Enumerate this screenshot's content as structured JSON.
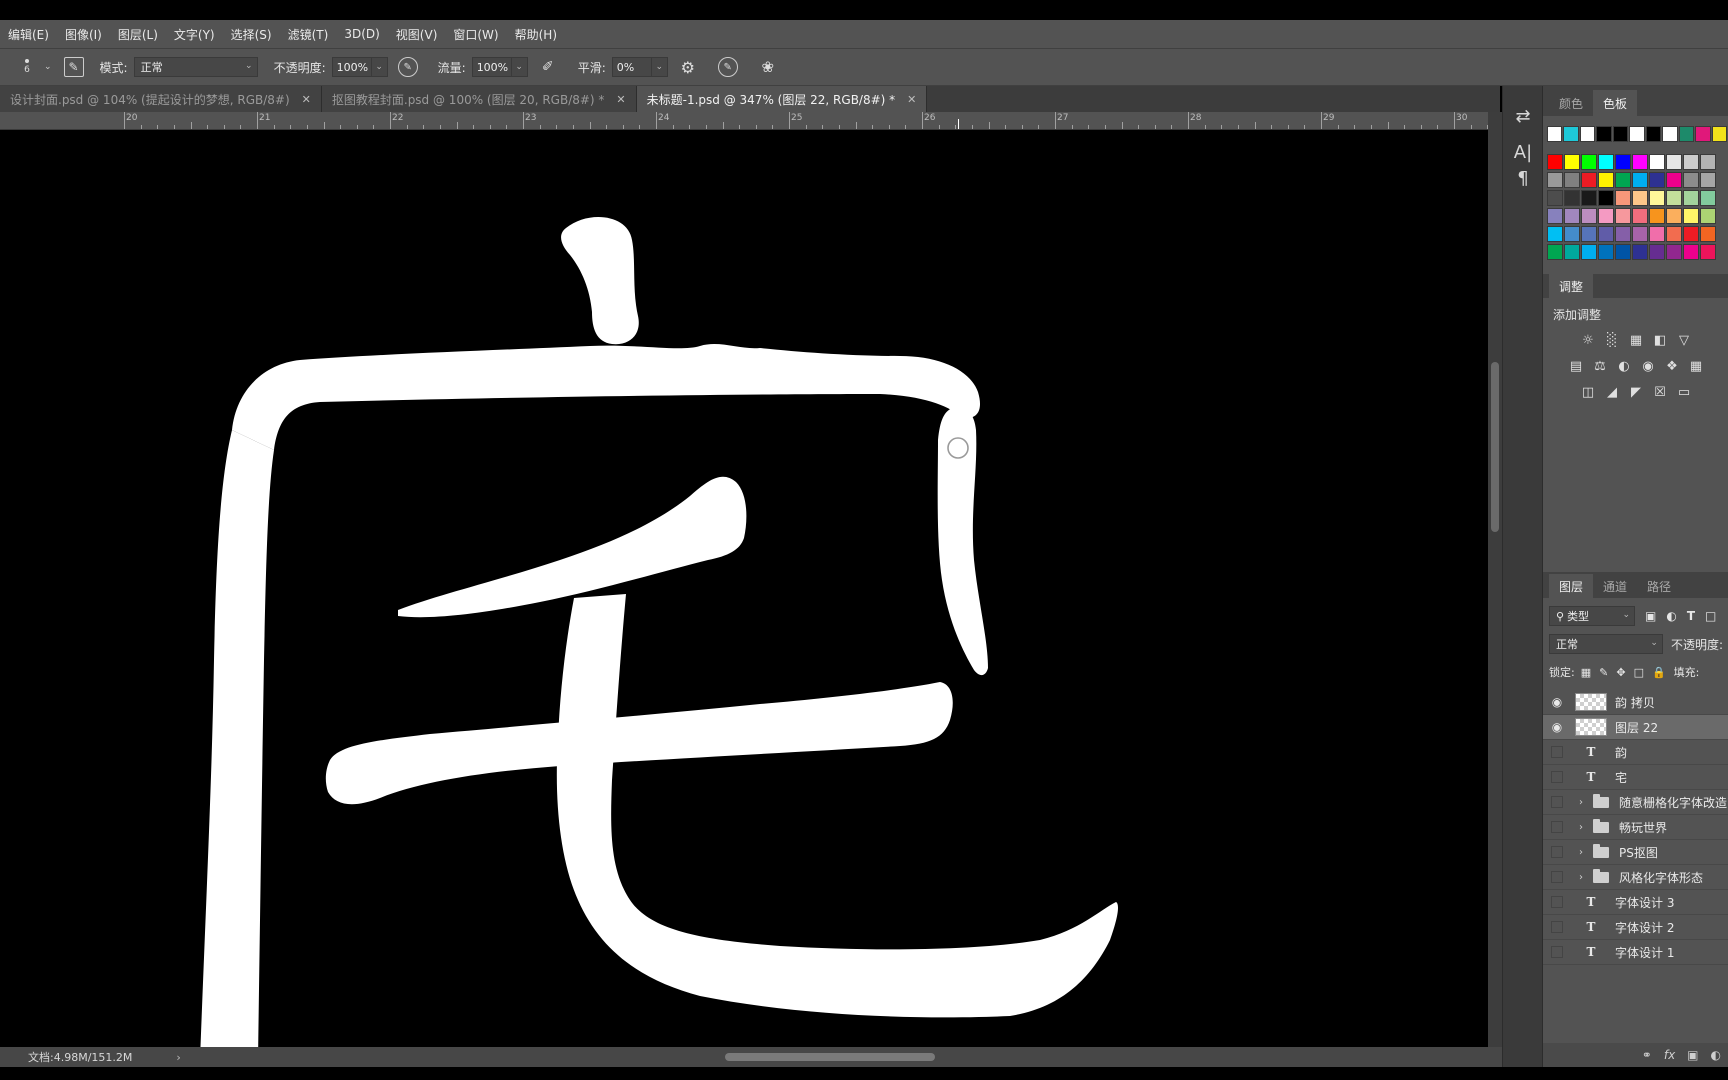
{
  "menu": [
    "编辑(E)",
    "图像(I)",
    "图层(L)",
    "文字(Y)",
    "选择(S)",
    "滤镜(T)",
    "3D(D)",
    "视图(V)",
    "窗口(W)",
    "帮助(H)"
  ],
  "options": {
    "brush_size": "6",
    "mode_label": "模式:",
    "mode_value": "正常",
    "opacity_label": "不透明度:",
    "opacity_value": "100%",
    "flow_label": "流量:",
    "flow_value": "100%",
    "smooth_label": "平滑:",
    "smooth_value": "0%"
  },
  "tabs": [
    {
      "label": "设计封面.psd @ 104% (提起设计的梦想, RGB/8#)",
      "active": false
    },
    {
      "label": "抠图教程封面.psd @ 100% (图层 20, RGB/8#) *",
      "active": false
    },
    {
      "label": "未标题-1.psd @ 347% (图层 22, RGB/8#) *",
      "active": true
    }
  ],
  "ruler_labels": [
    "20",
    "21",
    "22",
    "23",
    "24",
    "25",
    "26",
    "27",
    "28",
    "29",
    "30"
  ],
  "status": {
    "doc_info": "文档:4.98M/151.2M"
  },
  "panels": {
    "color_tabs": [
      "颜色",
      "色板"
    ],
    "adjust_tab": "调整",
    "adjust_add": "添加调整",
    "layer_tabs": [
      "图层",
      "通道",
      "路径"
    ],
    "filter_kind": "类型",
    "blend_mode": "正常",
    "opacity_label": "不透明度:",
    "lock_label": "锁定:",
    "fill_label": "填充:",
    "footer_fx": "fx"
  },
  "swatches": {
    "row0": [
      "#ffffff",
      "#1ec8d8",
      "#ffffff",
      "#000000",
      "#000000",
      "#ffffff",
      "#000000",
      "#ffffff",
      "#1d8a6a",
      "#e0187a",
      "#f2e21a"
    ],
    "grid": [
      [
        "#ff0000",
        "#ffff00",
        "#00ff00",
        "#00ffff",
        "#0000ff",
        "#ff00ff",
        "#ffffff",
        "#e6e6e6",
        "#cccccc",
        "#b3b3b3"
      ],
      [
        "#999999",
        "#808080",
        "#ed1c24",
        "#fff200",
        "#00a651",
        "#00aeef",
        "#2e3192",
        "#ec008c",
        "#8c8c8c",
        "#a6a6a6"
      ],
      [
        "#4d4d4d",
        "#333333",
        "#1a1a1a",
        "#000000",
        "#f7977a",
        "#fdc689",
        "#fff799",
        "#c4df9b",
        "#a3d39c",
        "#82ca9d"
      ],
      [
        "#8781bd",
        "#a187be",
        "#bc8dbf",
        "#f49ac2",
        "#f6989d",
        "#f26d7d",
        "#f7941d",
        "#fbaf5d",
        "#fff568",
        "#acd373"
      ],
      [
        "#00bff3",
        "#448ccb",
        "#5674b9",
        "#605ca8",
        "#855fa8",
        "#a763a8",
        "#f06eaa",
        "#f26c4f",
        "#ed1c24",
        "#f26522"
      ],
      [
        "#00a651",
        "#00a99d",
        "#00aeef",
        "#0072bc",
        "#0054a6",
        "#2e3192",
        "#662d91",
        "#92278f",
        "#ec008c",
        "#ed145b"
      ]
    ]
  },
  "layers": [
    {
      "type": "pixel",
      "name": "韵 拷贝",
      "visible": true,
      "selected": false
    },
    {
      "type": "pixel",
      "name": "图层 22",
      "visible": true,
      "selected": true
    },
    {
      "type": "text",
      "name": "韵",
      "visible": false,
      "selected": false
    },
    {
      "type": "text",
      "name": "宅",
      "visible": false,
      "selected": false
    },
    {
      "type": "group",
      "name": "随意栅格化字体改造",
      "visible": false,
      "selected": false
    },
    {
      "type": "group",
      "name": "畅玩世界",
      "visible": false,
      "selected": false
    },
    {
      "type": "group",
      "name": "PS抠图",
      "visible": false,
      "selected": false
    },
    {
      "type": "group",
      "name": "风格化字体形态",
      "visible": false,
      "selected": false
    },
    {
      "type": "text",
      "name": "字体设计 3",
      "visible": false,
      "selected": false
    },
    {
      "type": "text",
      "name": "字体设计 2",
      "visible": false,
      "selected": false
    },
    {
      "type": "text",
      "name": "字体设计 1",
      "visible": false,
      "selected": false
    }
  ],
  "icons": {
    "text_layer": "T",
    "eye": "eye-icon"
  }
}
